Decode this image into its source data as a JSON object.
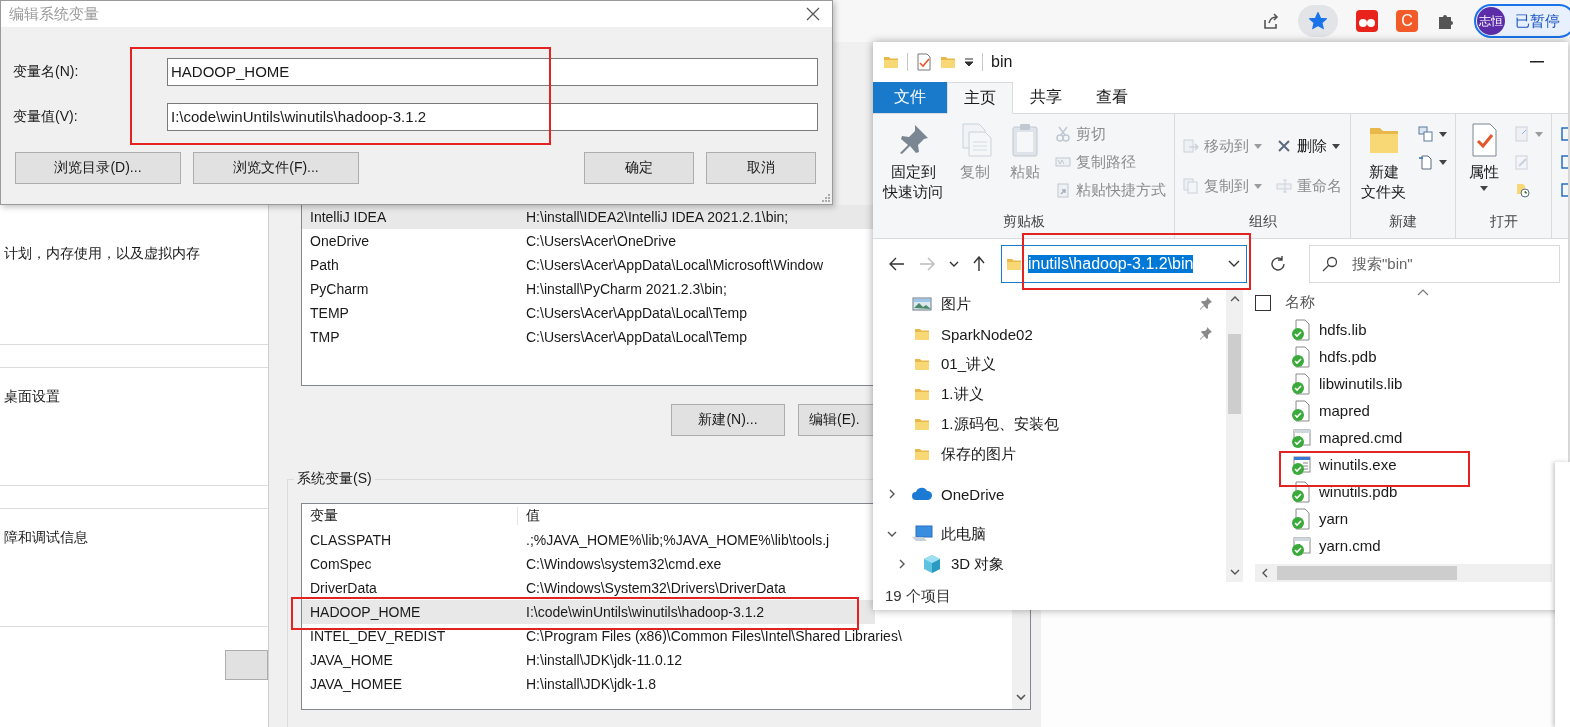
{
  "browser_toolbar": {
    "bookmarked": true,
    "extension_letter": "C",
    "profile": {
      "avatar_text": "志恒",
      "status": "已暂停"
    }
  },
  "system_properties": {
    "descriptions": [
      "计划，内存使用，以及虚拟内存",
      "桌面设置",
      "障和调试信息"
    ]
  },
  "environment_dialog": {
    "user_variables": {
      "rows": [
        {
          "name": "IntelliJ IDEA",
          "value": "H:\\install\\IDEA2\\IntelliJ IDEA 2021.2.1\\bin;",
          "selected": true
        },
        {
          "name": "OneDrive",
          "value": "C:\\Users\\Acer\\OneDrive",
          "selected": false
        },
        {
          "name": "Path",
          "value": "C:\\Users\\Acer\\AppData\\Local\\Microsoft\\Window",
          "selected": false
        },
        {
          "name": "PyCharm",
          "value": "H:\\install\\PyCharm 2021.2.3\\bin;",
          "selected": false
        },
        {
          "name": "TEMP",
          "value": "C:\\Users\\Acer\\AppData\\Local\\Temp",
          "selected": false
        },
        {
          "name": "TMP",
          "value": "C:\\Users\\Acer\\AppData\\Local\\Temp",
          "selected": false
        }
      ]
    },
    "user_buttons": [
      "新建(N)...",
      "编辑(E)."
    ],
    "system_variables": {
      "label": "系统变量(S)",
      "columns": [
        "变量",
        "值"
      ],
      "rows": [
        {
          "name": "CLASSPATH",
          "value": ".;%JAVA_HOME%\\lib;%JAVA_HOME%\\lib\\tools.j",
          "selected": false
        },
        {
          "name": "ComSpec",
          "value": "C:\\Windows\\system32\\cmd.exe",
          "selected": false
        },
        {
          "name": "DriverData",
          "value": "C:\\Windows\\System32\\Drivers\\DriverData",
          "selected": false
        },
        {
          "name": "HADOOP_HOME",
          "value": "I:\\code\\winUntils\\winutils\\hadoop-3.1.2",
          "selected": true
        },
        {
          "name": "INTEL_DEV_REDIST",
          "value": "C:\\Program Files (x86)\\Common Files\\Intel\\Shared Libraries\\",
          "selected": false
        },
        {
          "name": "JAVA_HOME",
          "value": "H:\\install\\JDK\\jdk-11.0.12",
          "selected": false
        },
        {
          "name": "JAVA_HOMEE",
          "value": "H:\\install\\JDK\\jdk-1.8",
          "selected": false
        }
      ]
    }
  },
  "edit_dialog": {
    "title": "编辑系统变量",
    "fields": [
      {
        "label": "变量名(N):",
        "value": "HADOOP_HOME"
      },
      {
        "label": "变量值(V):",
        "value": "I:\\code\\winUntils\\winutils\\hadoop-3.1.2"
      }
    ],
    "left_buttons": [
      "浏览目录(D)...",
      "浏览文件(F)..."
    ],
    "right_buttons": [
      "确定",
      "取消"
    ]
  },
  "explorer": {
    "title": "bin",
    "ribbon_tabs": [
      {
        "label": "文件",
        "kind": "file",
        "selected": false
      },
      {
        "label": "主页",
        "kind": "tab",
        "selected": true
      },
      {
        "label": "共享",
        "kind": "tab",
        "selected": false
      },
      {
        "label": "查看",
        "kind": "tab",
        "selected": false
      }
    ],
    "ribbon_groups": [
      {
        "label": "剪贴板",
        "items": [
          {
            "kind": "large",
            "lines": [
              "固定到",
              "快速访问"
            ],
            "disabled": false
          },
          {
            "kind": "large",
            "lines": [
              "复制"
            ],
            "disabled": true
          },
          {
            "kind": "large",
            "lines": [
              "粘贴"
            ],
            "disabled": true
          },
          {
            "kind": "small",
            "label": "剪切",
            "disabled": true
          },
          {
            "kind": "small",
            "label": "复制路径",
            "disabled": true
          },
          {
            "kind": "small",
            "label": "粘贴快捷方式",
            "disabled": true
          }
        ]
      },
      {
        "label": "组织",
        "items": [
          {
            "kind": "medium",
            "label": "移动到",
            "dropdown": true,
            "disabled": true
          },
          {
            "kind": "medium",
            "label": "复制到",
            "dropdown": true,
            "disabled": true
          },
          {
            "kind": "medium",
            "label": "删除",
            "dropdown": true,
            "disabled": false
          },
          {
            "kind": "medium",
            "label": "重命名",
            "dropdown": false,
            "disabled": true
          }
        ]
      },
      {
        "label": "新建",
        "items": [
          {
            "kind": "large",
            "lines": [
              "新建",
              "文件夹"
            ],
            "disabled": false
          },
          {
            "kind": "small",
            "dropdown": true,
            "disabled": false
          },
          {
            "kind": "small",
            "dropdown": true,
            "disabled": false
          }
        ]
      },
      {
        "label": "打开",
        "items": [
          {
            "kind": "large",
            "lines": [
              "属性"
            ],
            "dropdown": true,
            "disabled": false
          },
          {
            "kind": "small",
            "dropdown": true,
            "disabled": true
          },
          {
            "kind": "small",
            "dropdown": false,
            "disabled": true
          },
          {
            "kind": "small",
            "dropdown": false,
            "disabled": false
          }
        ]
      },
      {
        "items": [
          {
            "kind": "small",
            "disabled": false
          },
          {
            "kind": "small",
            "disabled": false
          },
          {
            "kind": "small",
            "disabled": false
          }
        ]
      }
    ],
    "address": {
      "text": "inutils\\hadoop-3.1.2\\bin",
      "selected": true
    },
    "search": {
      "placeholder": "搜索\"bin\""
    },
    "navigation": [
      {
        "label": "图片",
        "kind": "pictures",
        "pinned": true
      },
      {
        "label": "SparkNode02",
        "kind": "folder",
        "pinned": true
      },
      {
        "label": "01_讲义",
        "kind": "folder",
        "pinned": false
      },
      {
        "label": "1.讲义",
        "kind": "folder",
        "pinned": false
      },
      {
        "label": "1.源码包、安装包",
        "kind": "folder",
        "pinned": false
      },
      {
        "label": "保存的图片",
        "kind": "folder",
        "pinned": false
      },
      {
        "label": "OneDrive",
        "kind": "cloud",
        "pinned": false,
        "expanded": false
      },
      {
        "label": "此电脑",
        "kind": "pc",
        "pinned": false,
        "expanded": true,
        "children": [
          {
            "label": "3D 对象",
            "kind": "cube",
            "pinned": false,
            "expanded": false
          }
        ]
      }
    ],
    "file_header": {
      "label": "名称",
      "checked": false
    },
    "files": [
      {
        "name": "hdfs.lib",
        "kind": "file",
        "synced": true
      },
      {
        "name": "hdfs.pdb",
        "kind": "file",
        "synced": true
      },
      {
        "name": "libwinutils.lib",
        "kind": "file",
        "synced": true
      },
      {
        "name": "mapred",
        "kind": "file",
        "synced": true
      },
      {
        "name": "mapred.cmd",
        "kind": "cmd",
        "synced": true
      },
      {
        "name": "winutils.exe",
        "kind": "exe",
        "synced": true
      },
      {
        "name": "winutils.pdb",
        "kind": "file",
        "synced": true
      },
      {
        "name": "yarn",
        "kind": "file",
        "synced": true
      },
      {
        "name": "yarn.cmd",
        "kind": "cmd",
        "synced": true
      }
    ],
    "status": "19 个项目"
  }
}
